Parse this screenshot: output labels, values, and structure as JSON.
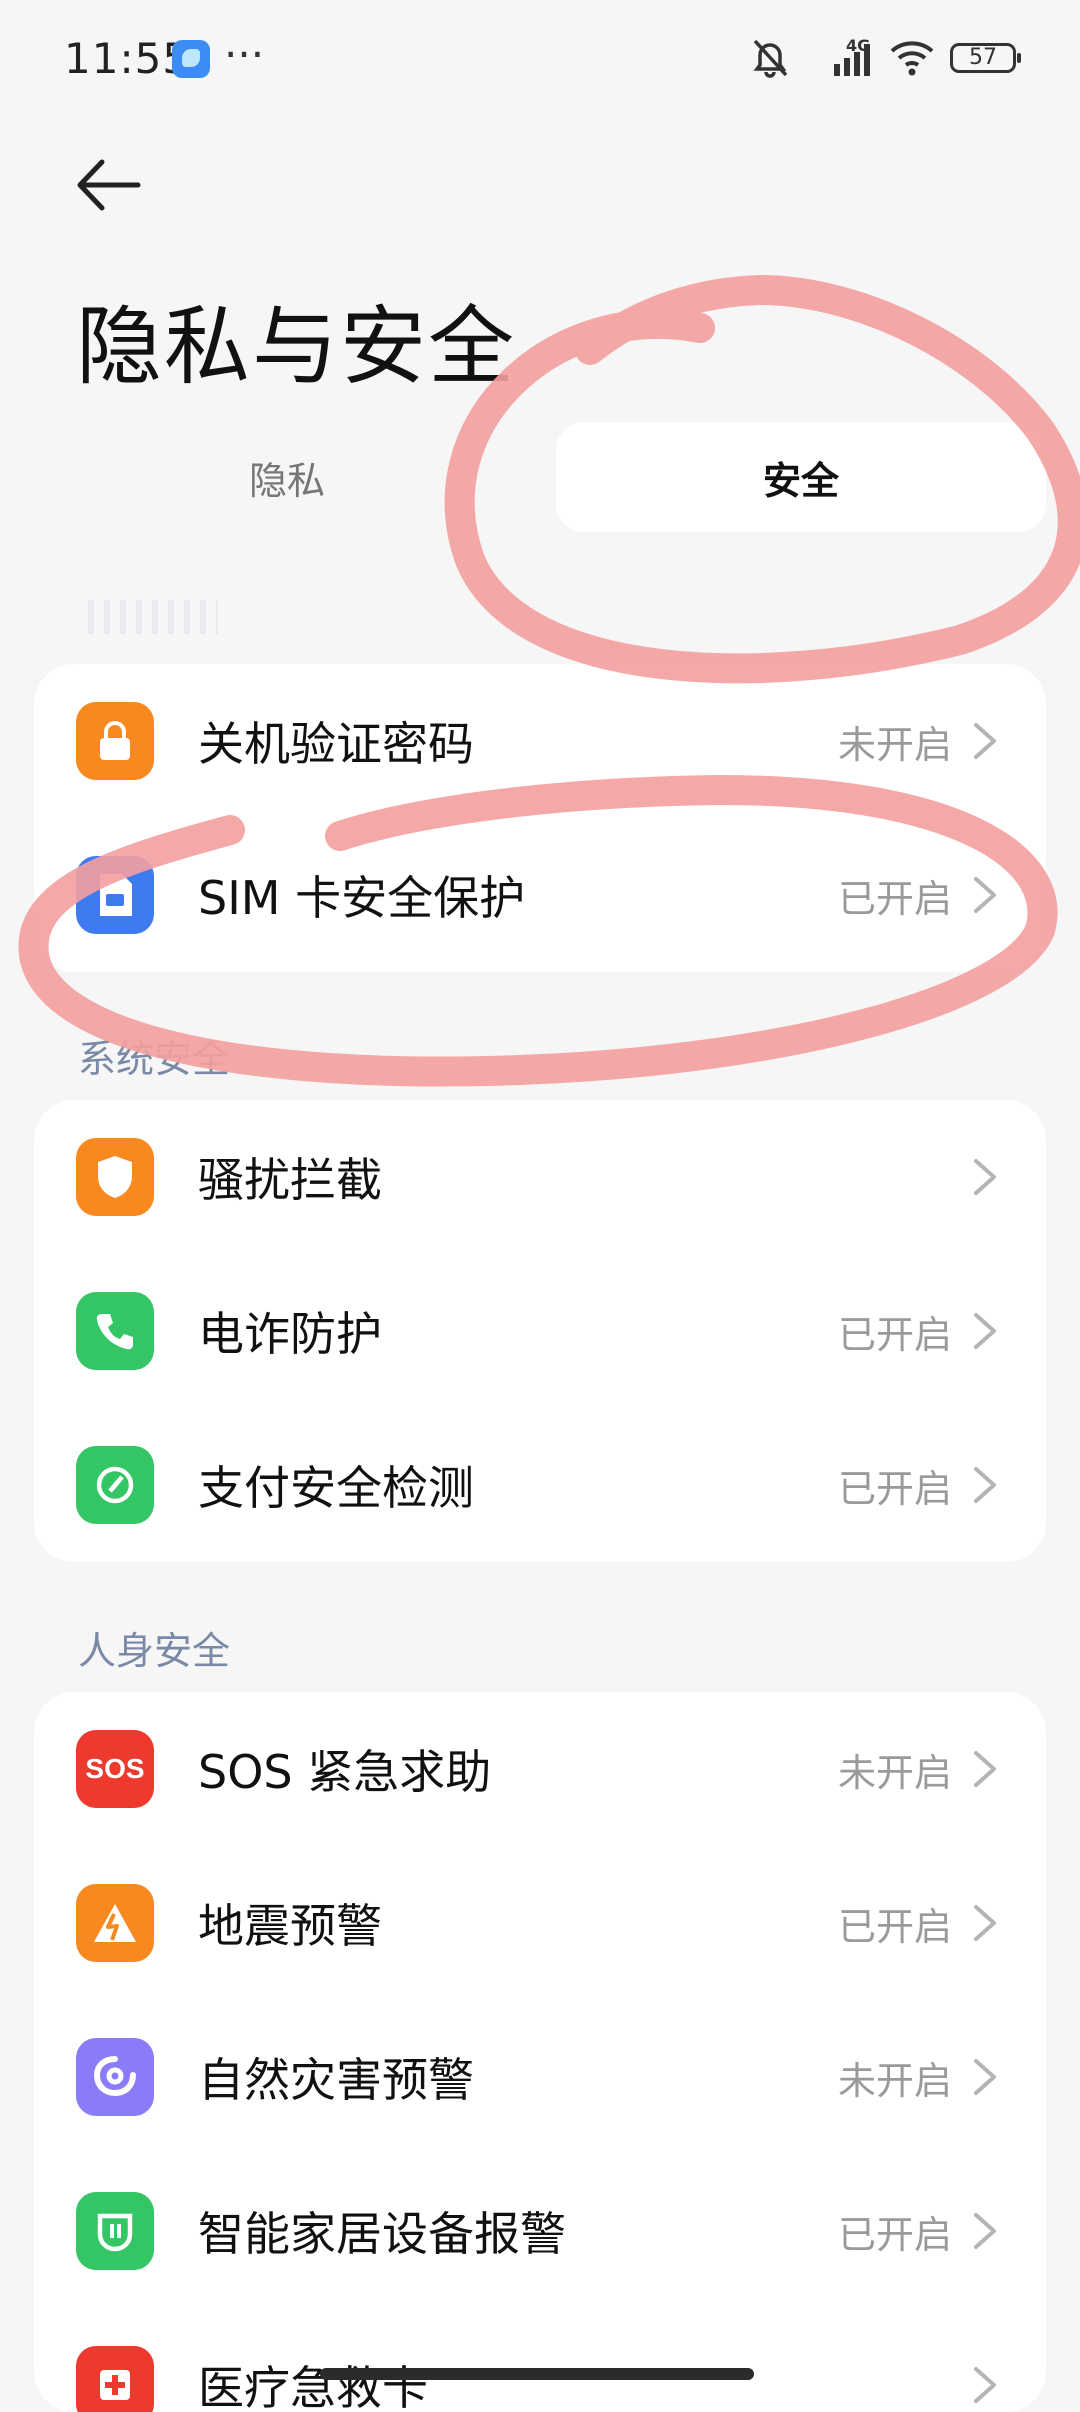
{
  "status_bar": {
    "time": "11:55",
    "more": "···",
    "network": "4G",
    "battery": "57",
    "icons": [
      "bell-muted-icon",
      "signal-icon",
      "wifi-icon",
      "battery-icon"
    ]
  },
  "header": {
    "back_icon": "arrow-left-icon",
    "title": "隐私与安全"
  },
  "tabs": [
    {
      "label": "隐私",
      "selected": false
    },
    {
      "label": "安全",
      "selected": true
    }
  ],
  "cards": {
    "top": [
      {
        "label": "关机验证密码",
        "status": "未开启",
        "icon": "lock-icon",
        "color": "#f7891f"
      },
      {
        "label": "SIM 卡安全保护",
        "status": "已开启",
        "icon": "sim-card-icon",
        "color": "#3e7bf0"
      }
    ],
    "system_label": "系统安全",
    "system": [
      {
        "label": "骚扰拦截",
        "status": "",
        "icon": "shield-icon",
        "color": "#f7891f"
      },
      {
        "label": "电诈防护",
        "status": "已开启",
        "icon": "phone-icon",
        "color": "#34c565"
      },
      {
        "label": "支付安全检测",
        "status": "已开启",
        "icon": "compass-icon",
        "color": "#34c565"
      }
    ],
    "personal_label": "人身安全",
    "personal": [
      {
        "label": "SOS 紧急求助",
        "status": "未开启",
        "icon": "sos-icon",
        "icon_text": "SOS",
        "color": "#ee3a2e"
      },
      {
        "label": "地震预警",
        "status": "已开启",
        "icon": "earthquake-icon",
        "color": "#f7891f"
      },
      {
        "label": "自然灾害预警",
        "status": "未开启",
        "icon": "cyclone-icon",
        "color": "#8a7cf6"
      },
      {
        "label": "智能家居设备报警",
        "status": "已开启",
        "icon": "home-device-icon",
        "color": "#34c565"
      },
      {
        "label": "医疗急救卡",
        "status": "",
        "icon": "medical-cross-icon",
        "color": "#ee3a2e"
      }
    ]
  }
}
